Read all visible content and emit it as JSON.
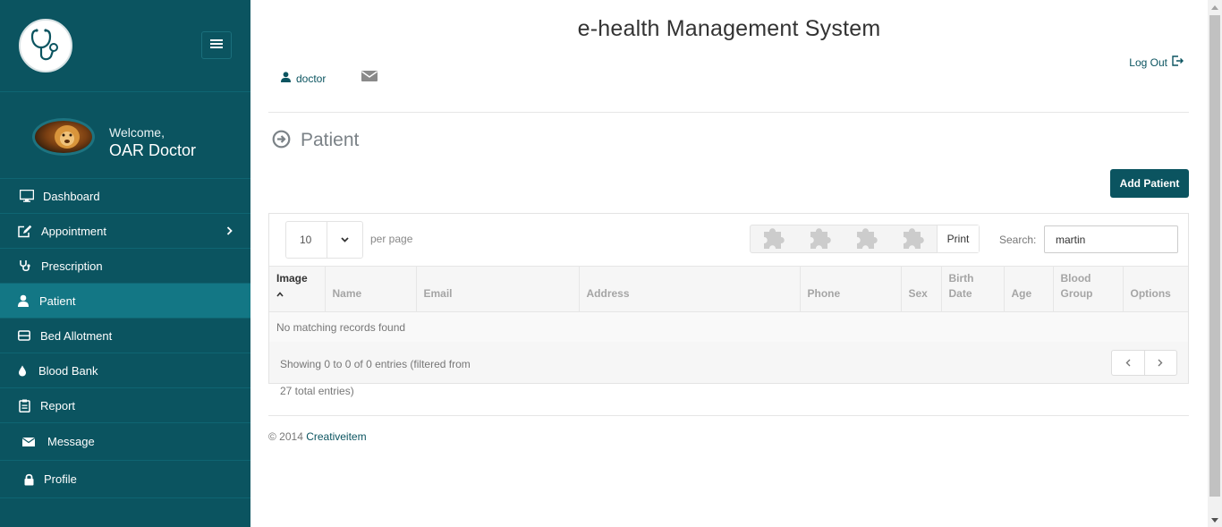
{
  "sidebar": {
    "welcome": "Welcome,",
    "user_name": "OAR Doctor",
    "items": [
      {
        "label": "Dashboard",
        "icon": "monitor-icon"
      },
      {
        "label": "Appointment",
        "icon": "edit-icon",
        "has_submenu": true
      },
      {
        "label": "Prescription",
        "icon": "stethoscope-icon"
      },
      {
        "label": "Patient",
        "icon": "user-icon",
        "active": true
      },
      {
        "label": "Bed Allotment",
        "icon": "bed-icon"
      },
      {
        "label": "Blood Bank",
        "icon": "drop-icon"
      },
      {
        "label": "Report",
        "icon": "clipboard-icon"
      },
      {
        "label": "Message",
        "icon": "envelope-icon"
      },
      {
        "label": "Profile",
        "icon": "lock-icon"
      }
    ]
  },
  "header": {
    "title": "e-health Management System",
    "user_label": "doctor",
    "logout_label": "Log Out"
  },
  "page": {
    "title": "Patient",
    "add_button": "Add Patient"
  },
  "table_controls": {
    "page_length": "10",
    "per_page_label": "per page",
    "print_label": "Print",
    "search_label": "Search:",
    "search_value": "martin"
  },
  "table": {
    "columns": [
      "Image",
      "Name",
      "Email",
      "Address",
      "Phone",
      "Sex",
      "Birth Date",
      "Age",
      "Blood Group",
      "Options"
    ],
    "sorted_column": "Image",
    "empty_message": "No matching records found",
    "info": "Showing 0 to 0 of 0 entries (filtered from",
    "info_continued": "27 total entries)"
  },
  "footer": {
    "copyright": "© 2014",
    "link": "Creativeitem"
  },
  "colors": {
    "sidebar_bg": "#0b5460",
    "sidebar_active": "#137785",
    "accent": "#0b5460"
  }
}
